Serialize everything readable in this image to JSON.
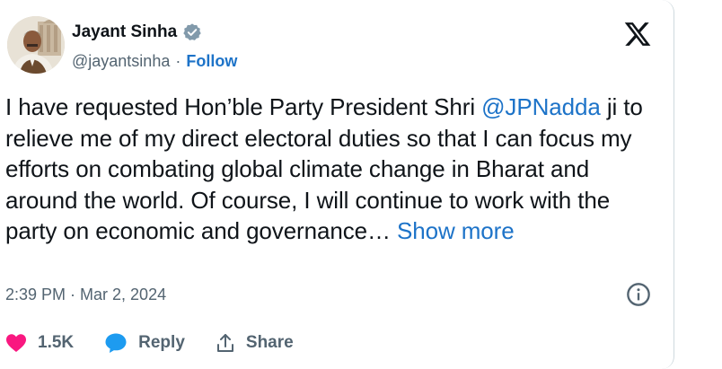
{
  "author": {
    "name": "Jayant Sinha",
    "handle": "@jayantsinha",
    "separator": "·",
    "follow_label": "Follow",
    "verified_icon": "verified-badge-icon",
    "avatar_icon": "profile-photo"
  },
  "brand": {
    "logo_icon": "x-logo-icon"
  },
  "tweet": {
    "text_part1": "I have requested Hon’ble Party President Shri ",
    "mention": "@JPNadda",
    "text_part2": " ji to relieve me of my direct electoral duties so that I can focus my efforts on combating global climate change in Bharat and around the world. Of course, I will continue to work with the party on economic and governance… ",
    "show_more_label": "Show more"
  },
  "meta": {
    "timestamp": "2:39 PM · Mar 2, 2024",
    "info_icon": "info-icon"
  },
  "actions": {
    "like_count": "1.5K",
    "reply_label": "Reply",
    "share_label": "Share"
  },
  "colors": {
    "accent": "#1d73c8",
    "like": "#f91880",
    "reply_icon": "#1d9bf0",
    "muted": "#536471",
    "text": "#0f1419"
  }
}
